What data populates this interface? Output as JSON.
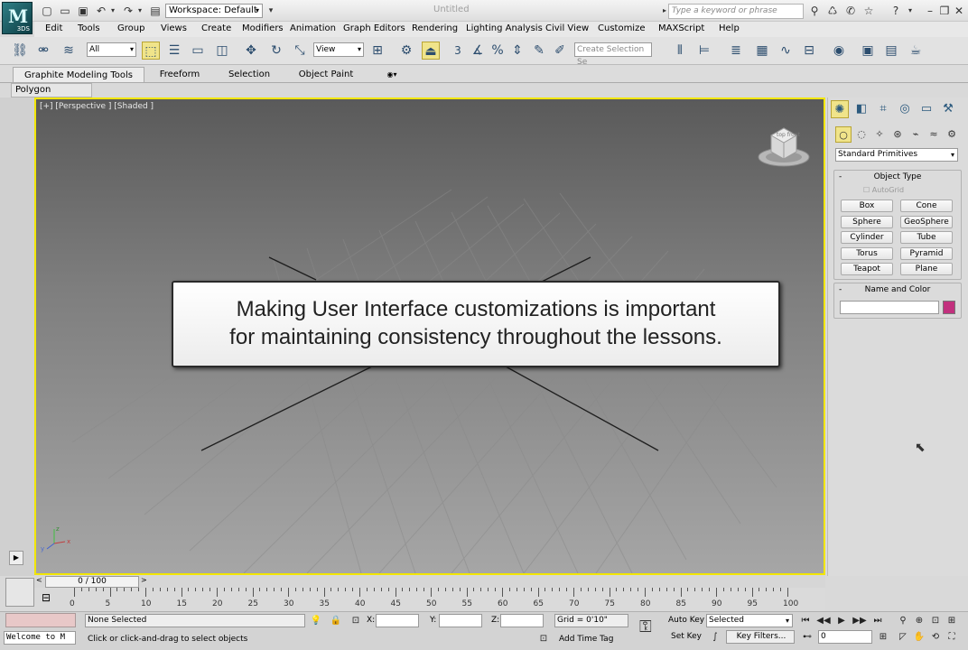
{
  "app": {
    "logo_text": "3DS",
    "title": "Untitled"
  },
  "quick_access": {
    "workspace": "Workspace: Default"
  },
  "infocenter": {
    "search_placeholder": "Type a keyword or phrase"
  },
  "menu": [
    "Edit",
    "Tools",
    "Group",
    "Views",
    "Create",
    "Modifiers",
    "Animation",
    "Graph Editors",
    "Rendering",
    "Lighting Analysis",
    "Civil View",
    "Customize",
    "MAXScript",
    "Help"
  ],
  "toolbar": {
    "selection_filter": "All",
    "ref_coord": "View",
    "snap_label": "3",
    "named_selection_placeholder": "Create Selection Se"
  },
  "ribbon": {
    "tabs": [
      "Graphite Modeling Tools",
      "Freeform",
      "Selection",
      "Object Paint"
    ],
    "panel": "Polygon Modeling"
  },
  "viewport": {
    "label": "[+] [Perspective ] [Shaded ]",
    "cube_text": "top front"
  },
  "note": {
    "line1": "Making User Interface customizations is important",
    "line2": "for maintaining consistency throughout the lessons."
  },
  "command_panel": {
    "category": "Standard Primitives",
    "object_type_title": "Object Type",
    "autogrid": "AutoGrid",
    "primitives": [
      "Box",
      "Cone",
      "Sphere",
      "GeoSphere",
      "Cylinder",
      "Tube",
      "Torus",
      "Pyramid",
      "Teapot",
      "Plane"
    ],
    "name_color_title": "Name and Color",
    "object_color": "#c2317e"
  },
  "timeline": {
    "position": "0 / 100",
    "ticks": [
      "0",
      "5",
      "10",
      "15",
      "20",
      "25",
      "30",
      "35",
      "40",
      "45",
      "50",
      "55",
      "60",
      "65",
      "70",
      "75",
      "80",
      "85",
      "90",
      "95",
      "100"
    ]
  },
  "status": {
    "listener": "Welcome to M",
    "selection": "None Selected",
    "prompt": "Click or click-and-drag to select objects",
    "x_label": "X:",
    "y_label": "Y:",
    "z_label": "Z:",
    "grid": "Grid = 0'10\"",
    "add_time_tag": "Add Time Tag",
    "auto_key": "Auto Key",
    "set_key": "Set Key",
    "key_mode": "Selected",
    "key_filters": "Key Filters...",
    "frame": "0"
  },
  "colors": {
    "viewport_border": "#f2e600",
    "active_button": "#f0e48a"
  }
}
